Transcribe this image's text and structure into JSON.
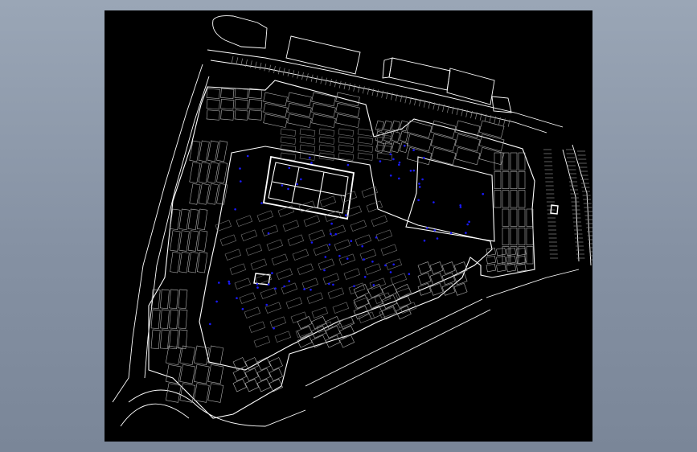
{
  "viewer": {
    "canvas_background": "#000000",
    "window_background": "#8c98aa"
  },
  "drawing": {
    "line_color": "#ffffff",
    "gray_color": "#8a8a8a",
    "marker_color": "#1a1aff",
    "icons": [
      "cad-site-plan"
    ]
  }
}
